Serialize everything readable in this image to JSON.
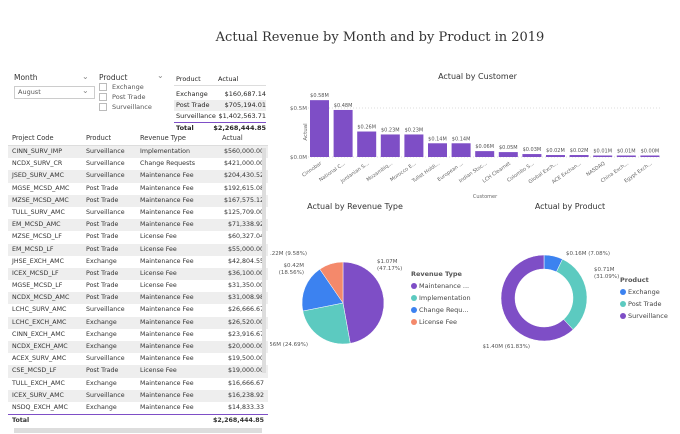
{
  "title": "Actual Revenue by Month and by Product in 2019",
  "month_slicer": {
    "label": "Month",
    "value": "August"
  },
  "product_slicer": {
    "label": "Product",
    "options": [
      "Exchange",
      "Post Trade",
      "Surveillance"
    ]
  },
  "product_table": {
    "headers": [
      "Product",
      "Actual"
    ],
    "rows": [
      [
        "Exchange",
        "$160,687.14"
      ],
      [
        "Post Trade",
        "$705,194.01"
      ],
      [
        "Surveillance",
        "$1,402,563.71"
      ]
    ],
    "total": [
      "Total",
      "$2,268,444.85"
    ]
  },
  "detail_table": {
    "headers": [
      "Project Code",
      "Product",
      "Revenue Type",
      "Actual"
    ],
    "rows": [
      [
        "CINN_SURV_IMP",
        "Surveillance",
        "Implementation",
        "$560,000.00"
      ],
      [
        "NCDX_SURV_CR",
        "Surveillance",
        "Change Requests",
        "$421,000.00"
      ],
      [
        "JSED_SURV_AMC",
        "Surveillance",
        "Maintenance Fee",
        "$204,430.52"
      ],
      [
        "MGSE_MCSD_AMC",
        "Post Trade",
        "Maintenance Fee",
        "$192,615.08"
      ],
      [
        "MZSE_MCSD_AMC",
        "Post Trade",
        "Maintenance Fee",
        "$167,575.12"
      ],
      [
        "TULL_SURV_AMC",
        "Surveillance",
        "Maintenance Fee",
        "$125,709.00"
      ],
      [
        "EM_MCSD_AMC",
        "Post Trade",
        "Maintenance Fee",
        "$71,338.92"
      ],
      [
        "MZSE_MCSD_LF",
        "Post Trade",
        "License Fee",
        "$60,327.04"
      ],
      [
        "EM_MCSD_LF",
        "Post Trade",
        "License Fee",
        "$55,000.00"
      ],
      [
        "JHSE_EXCH_AMC",
        "Exchange",
        "Maintenance Fee",
        "$42,804.55"
      ],
      [
        "ICEX_MCSD_LF",
        "Post Trade",
        "License Fee",
        "$36,100.00"
      ],
      [
        "MGSE_MCSD_LF",
        "Post Trade",
        "License Fee",
        "$31,350.00"
      ],
      [
        "NCDX_MCSD_AMC",
        "Post Trade",
        "Maintenance Fee",
        "$31,008.98"
      ],
      [
        "LCHC_SURV_AMC",
        "Surveillance",
        "Maintenance Fee",
        "$26,666.67"
      ],
      [
        "LCHC_EXCH_AMC",
        "Exchange",
        "Maintenance Fee",
        "$26,520.00"
      ],
      [
        "CINN_EXCH_AMC",
        "Exchange",
        "Maintenance Fee",
        "$23,916.67"
      ],
      [
        "NCDX_EXCH_AMC",
        "Exchange",
        "Maintenance Fee",
        "$20,000.00"
      ],
      [
        "ACEX_SURV_AMC",
        "Surveillance",
        "Maintenance Fee",
        "$19,500.00"
      ],
      [
        "CSE_MCSD_LF",
        "Post Trade",
        "License Fee",
        "$19,000.00"
      ],
      [
        "TULL_EXCH_AMC",
        "Exchange",
        "Maintenance Fee",
        "$16,666.67"
      ],
      [
        "ICEX_SURV_AMC",
        "Surveillance",
        "Maintenance Fee",
        "$16,238.92"
      ],
      [
        "NSDQ_EXCH_AMC",
        "Exchange",
        "Maintenance Fee",
        "$14,833.33"
      ]
    ],
    "total": [
      "Total",
      "$2,268,444.85"
    ]
  },
  "chart_data": [
    {
      "type": "bar",
      "title": "Actual by Customer",
      "xlabel": "Customer",
      "ylabel": "Actual",
      "ylim": [
        0,
        0.6
      ],
      "yticks": [
        "$0.0M",
        "$0.5M"
      ],
      "color": "#7e4ec6",
      "categories": [
        "Cinnobar",
        "National C...",
        "Jordanian S...",
        "Mozambiq...",
        "Morocco E...",
        "Tullet Holdi...",
        "European ...",
        "Indian Stoc...",
        "LCH Clearnet",
        "Colombo S...",
        "Global Exch...",
        "ACE Exchan...",
        "NASDAQ",
        "China Exch...",
        "Egypt Exch..."
      ],
      "values": [
        0.58,
        0.48,
        0.26,
        0.23,
        0.23,
        0.14,
        0.14,
        0.06,
        0.05,
        0.03,
        0.02,
        0.02,
        0.01,
        0.01,
        0.0
      ],
      "labels": [
        "$0.58M",
        "$0.48M",
        "$0.26M",
        "$0.23M",
        "$0.23M",
        "$0.14M",
        "$0.14M",
        "$0.06M",
        "$0.05M",
        "$0.03M",
        "$0.02M",
        "$0.02M",
        "$0.01M",
        "$0.01M",
        "$0.00M"
      ]
    },
    {
      "type": "pie",
      "title": "Actual by Revenue Type",
      "legend_title": "Revenue Type",
      "legend": [
        "Maintenance ...",
        "Implementation",
        "Change Requ...",
        "License Fee"
      ],
      "slices": [
        {
          "name": "Maintenance Fee",
          "value": 1.07,
          "pct": 47.17,
          "label": "$1.07M (47.17%)",
          "color": "#7e4ec6"
        },
        {
          "name": "Implementation",
          "value": 0.56,
          "pct": 24.69,
          "label": "$0.56M (24.69%)",
          "color": "#5ccac0"
        },
        {
          "name": "Change Requests",
          "value": 0.42,
          "pct": 18.56,
          "label": "$0.42M (18.56%)",
          "color": "#3c82f0"
        },
        {
          "name": "License Fee",
          "value": 0.22,
          "pct": 9.58,
          "label": "$0.22M (9.58%)",
          "color": "#f4896b"
        }
      ]
    },
    {
      "type": "donut",
      "title": "Actual by Product",
      "legend_title": "Product",
      "legend": [
        "Exchange",
        "Post Trade",
        "Surveillance"
      ],
      "slices": [
        {
          "name": "Exchange",
          "value": 0.16,
          "pct": 7.08,
          "label": "$0.16M (7.08%)",
          "color": "#3c82f0"
        },
        {
          "name": "Post Trade",
          "value": 0.71,
          "pct": 31.09,
          "label": "$0.71M (31.09%)",
          "color": "#5ccac0"
        },
        {
          "name": "Surveillance",
          "value": 1.4,
          "pct": 61.83,
          "label": "$1.40M (61.83%)",
          "color": "#7e4ec6"
        }
      ]
    }
  ]
}
